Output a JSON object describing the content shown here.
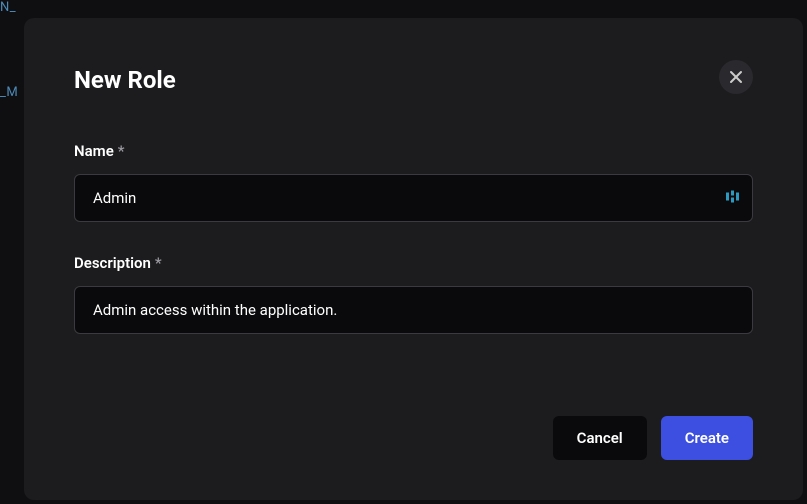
{
  "modal": {
    "title": "New Role",
    "fields": {
      "name": {
        "label": "Name",
        "required_marker": "*",
        "value": "Admin"
      },
      "description": {
        "label": "Description",
        "required_marker": "*",
        "value": "Admin access within the application."
      }
    },
    "buttons": {
      "cancel": "Cancel",
      "create": "Create"
    }
  },
  "background": {
    "fragment_top": "N_",
    "fragment_left": "_M"
  }
}
